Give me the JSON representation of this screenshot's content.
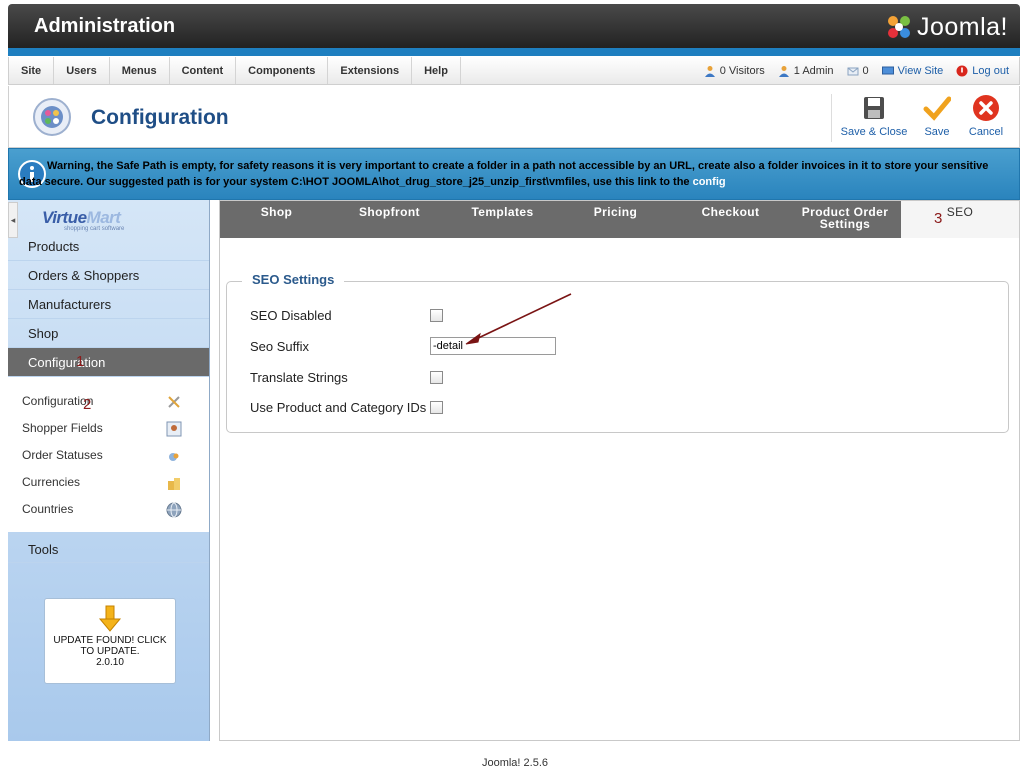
{
  "header": {
    "title": "Administration",
    "logo_text": "Joomla!"
  },
  "menubar": {
    "items": [
      "Site",
      "Users",
      "Menus",
      "Content",
      "Components",
      "Extensions",
      "Help"
    ],
    "status": {
      "visitors": "0 Visitors",
      "admin": "1 Admin",
      "messages": "0",
      "view_site": "View Site",
      "logout": "Log out"
    }
  },
  "toolbar": {
    "title": "Configuration",
    "save_close": "Save & Close",
    "save": "Save",
    "cancel": "Cancel"
  },
  "warning": {
    "text": "Warning, the Safe Path is empty, for safety reasons it is very important to create a folder in a path not accessible by an URL, create also a folder invoices in it to store your sensitive data secure. Our suggested path is for your system C:\\HOT JOOMLA\\hot_drug_store_j25_unzip_first\\vmfiles, use this link to the ",
    "link": "config"
  },
  "sidebar": {
    "logo_virtue": "Virtue",
    "logo_mart": "Mart",
    "logo_tagline": "shopping cart software",
    "categories": [
      "Products",
      "Orders & Shoppers",
      "Manufacturers",
      "Shop",
      "Configuration"
    ],
    "sub_items": [
      "Configuration",
      "Shopper Fields",
      "Order Statuses",
      "Currencies",
      "Countries"
    ],
    "tools": "Tools",
    "update": {
      "line1": "UPDATE FOUND! CLICK",
      "line2": "TO UPDATE.",
      "version": "2.0.10"
    }
  },
  "tabs": {
    "shop": "Shop",
    "shopfront": "Shopfront",
    "templates": "Templates",
    "pricing": "Pricing",
    "checkout": "Checkout",
    "product_order_1": "Product Order",
    "product_order_2": "Settings",
    "seo": "SEO"
  },
  "seo": {
    "legend": "SEO Settings",
    "seo_disabled": "SEO Disabled",
    "seo_suffix": "Seo Suffix",
    "seo_suffix_value": "-detail",
    "translate_strings": "Translate Strings",
    "use_ids": "Use Product and Category IDs"
  },
  "annotations": {
    "a1": "1",
    "a2": "2",
    "a3": "3"
  },
  "footer": "Joomla! 2.5.6",
  "colors": {
    "header_stripe": "#1e7fc0",
    "warning_bg": "#3a92c8",
    "title": "#1f4e86",
    "annotation": "#8b1a1a"
  }
}
